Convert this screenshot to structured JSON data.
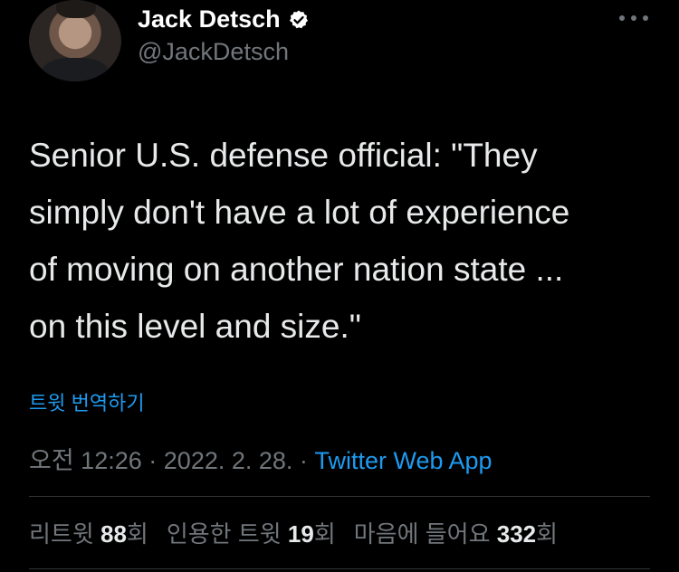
{
  "author": {
    "display_name": "Jack Detsch",
    "handle": "@JackDetsch",
    "verified_icon": "verified-badge-icon",
    "avatar_icon": "profile-photo"
  },
  "more_icon": "more-options-icon",
  "tweet": {
    "text": "Senior U.S. defense official: \"They\nsimply don't have a lot of experience\nof moving on another nation state ...\non this level and size.\"",
    "translate_label": "트윗 번역하기",
    "time": "오전 12:26",
    "separator": "·",
    "date": "2022. 2. 28.",
    "source": "Twitter Web App"
  },
  "stats": {
    "retweets_label": "리트윗",
    "retweets_count": "88",
    "retweets_suffix": "회",
    "quotes_label": "인용한 트윗",
    "quotes_count": "19",
    "quotes_suffix": "회",
    "likes_label": "마음에 들어요",
    "likes_count": "332",
    "likes_suffix": "회"
  },
  "colors": {
    "background": "#000000",
    "text": "#e7e9ea",
    "secondary": "#71767b",
    "accent": "#1d9bf0",
    "divider": "#2f3336"
  }
}
